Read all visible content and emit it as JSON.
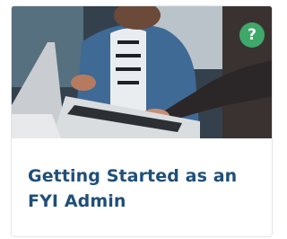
{
  "card": {
    "title": "Getting Started as an FYI Admin",
    "image_icon": "help-question-icon",
    "badge_glyph": "?",
    "colors": {
      "title": "#1f4f79",
      "badge": "#3fa96a",
      "border": "#e2e5e9"
    }
  }
}
